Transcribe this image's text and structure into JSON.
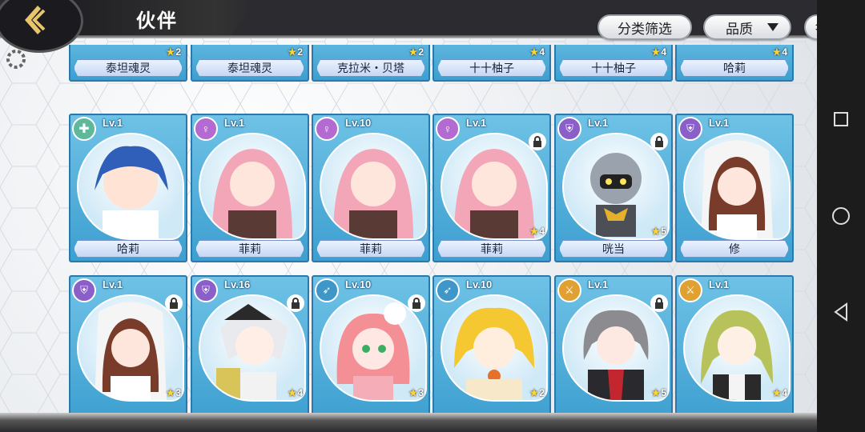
{
  "header": {
    "title": "伙伴",
    "filter_label": "分类筛选",
    "quality_label": "品质"
  },
  "colors": {
    "card_blue": "#3d9fd0",
    "heal": "#5fb89a",
    "support": "#b36bd1",
    "tank": "#8a5fc8",
    "ranged": "#3f97c9",
    "attack": "#e0a132"
  },
  "partial_row": [
    {
      "name": "泰坦魂灵",
      "stars": "2"
    },
    {
      "name": "泰坦魂灵",
      "stars": "2"
    },
    {
      "name": "克拉米・贝塔",
      "stars": "2"
    },
    {
      "name": "十十柚子",
      "stars": "4"
    },
    {
      "name": "十十柚子",
      "stars": "4"
    },
    {
      "name": "哈莉",
      "stars": "4"
    }
  ],
  "row1": [
    {
      "name": "哈莉",
      "level": "Lv.1",
      "class": "heal-icon",
      "locked": false,
      "stars": ""
    },
    {
      "name": "菲莉",
      "level": "Lv.1",
      "class": "support-icon",
      "locked": false,
      "stars": ""
    },
    {
      "name": "菲莉",
      "level": "Lv.10",
      "class": "support-icon",
      "locked": false,
      "stars": ""
    },
    {
      "name": "菲莉",
      "level": "Lv.1",
      "class": "support-icon",
      "locked": true,
      "stars": "4"
    },
    {
      "name": "咣当",
      "level": "Lv.1",
      "class": "tank-icon",
      "locked": true,
      "stars": "5"
    },
    {
      "name": "修",
      "level": "Lv.1",
      "class": "tank-icon",
      "locked": false,
      "stars": ""
    }
  ],
  "row2": [
    {
      "level": "Lv.1",
      "class": "tank-icon",
      "locked": true,
      "stars": "3"
    },
    {
      "level": "Lv.16",
      "class": "tank-icon",
      "locked": true,
      "stars": "4"
    },
    {
      "level": "Lv.10",
      "class": "ranged-icon",
      "locked": true,
      "stars": "3"
    },
    {
      "level": "Lv.10",
      "class": "ranged-icon",
      "locked": false,
      "stars": "2"
    },
    {
      "level": "Lv.1",
      "class": "attack-icon",
      "locked": true,
      "stars": "5"
    },
    {
      "level": "Lv.1",
      "class": "attack-icon",
      "locked": false,
      "stars": "4"
    }
  ]
}
